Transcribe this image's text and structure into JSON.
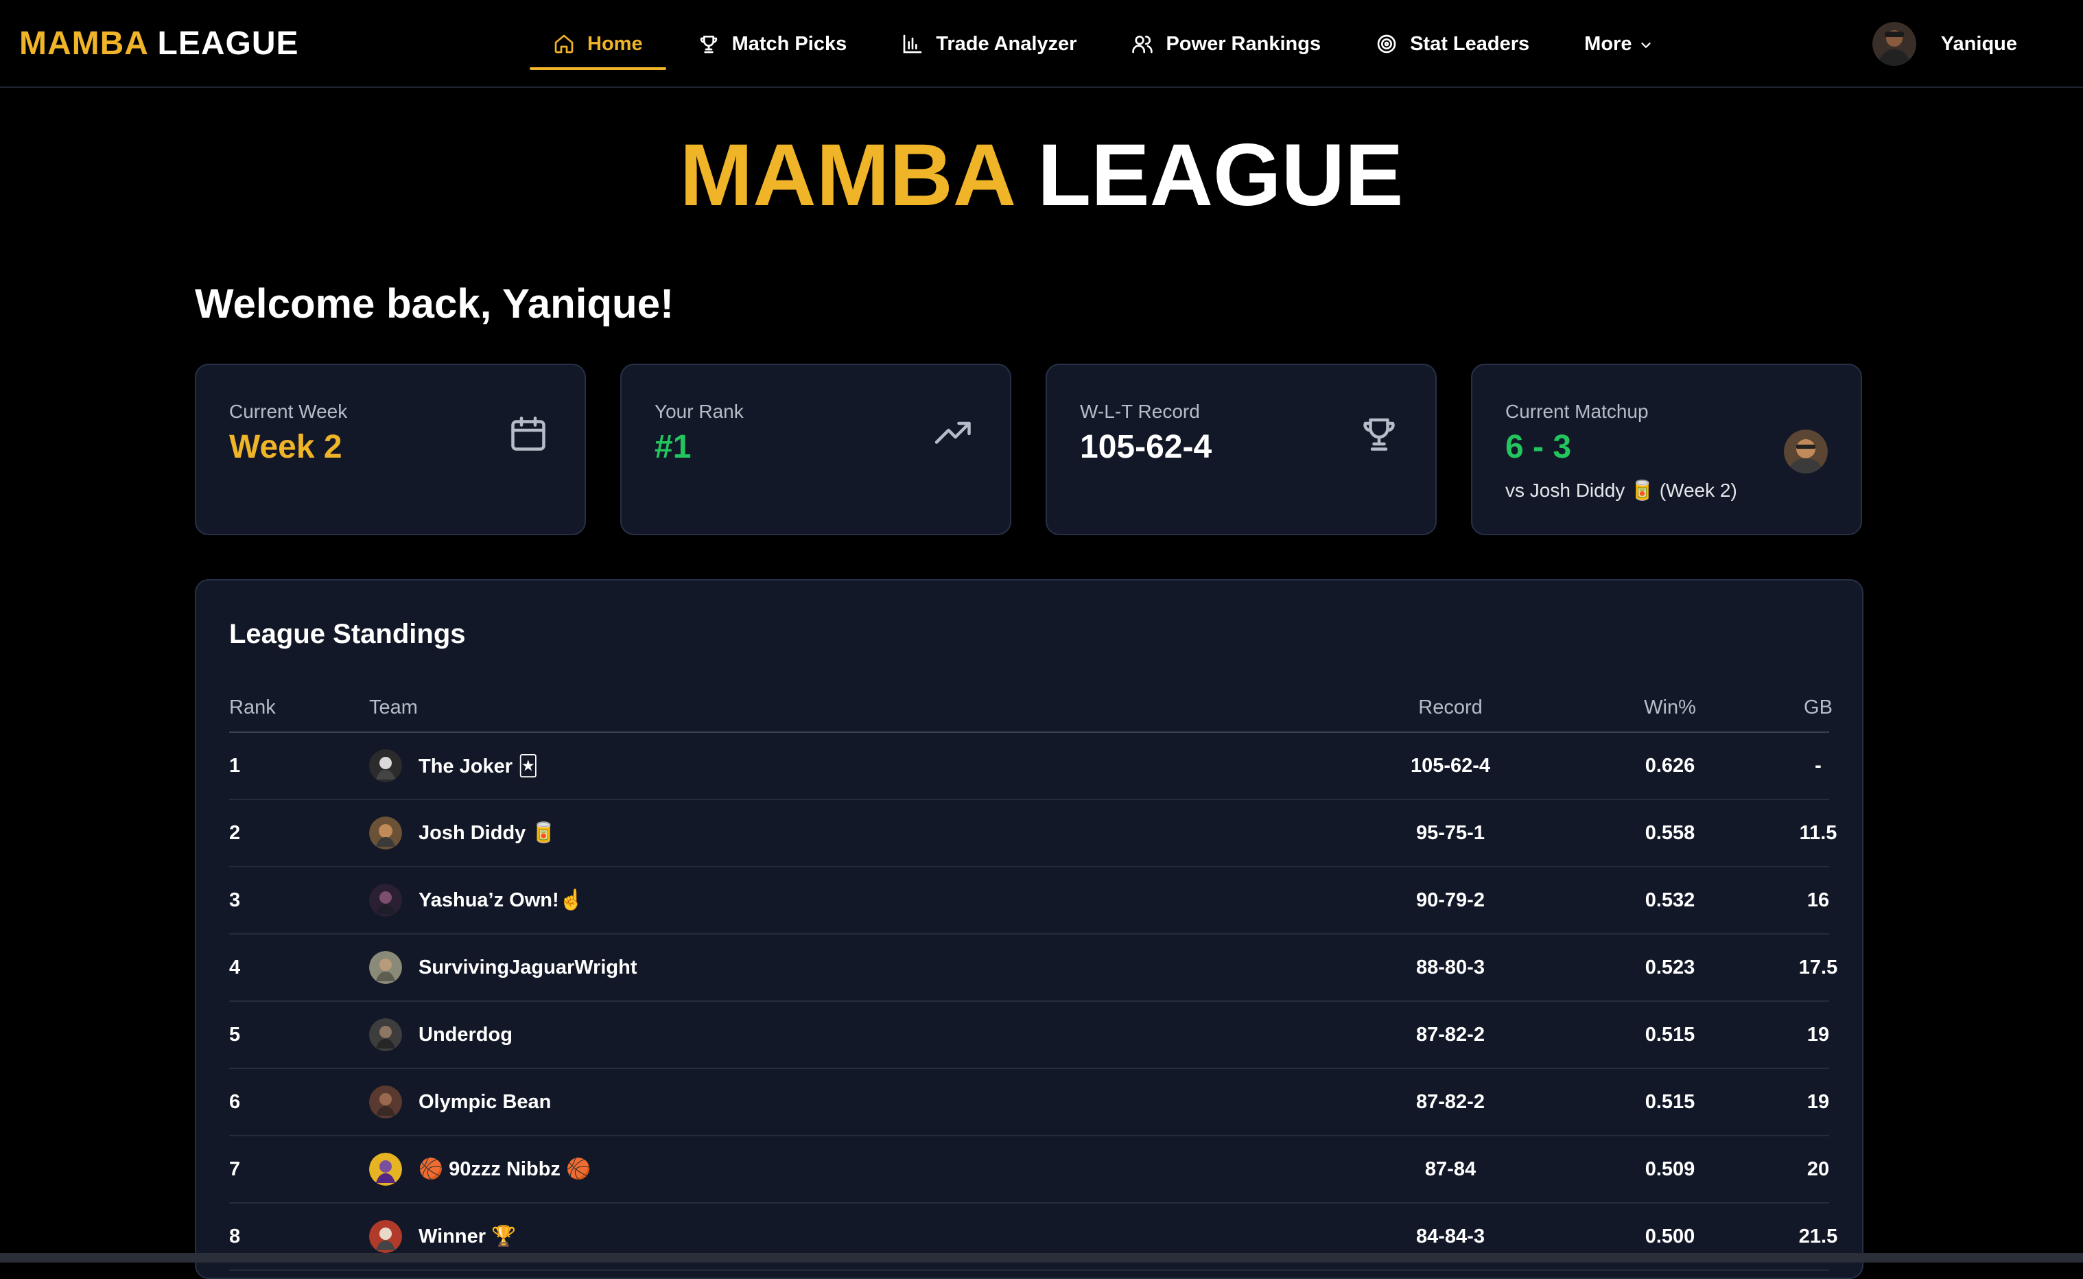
{
  "nav": {
    "brand_gold": "MAMBA",
    "brand_white": "LEAGUE",
    "links": [
      {
        "label": "Home",
        "icon": "home-icon"
      },
      {
        "label": "Match Picks",
        "icon": "trophy-icon"
      },
      {
        "label": "Trade Analyzer",
        "icon": "bar-chart-icon"
      },
      {
        "label": "Power Rankings",
        "icon": "users-icon"
      },
      {
        "label": "Stat Leaders",
        "icon": "target-icon"
      },
      {
        "label": "More",
        "icon": "chevron-down-icon"
      }
    ],
    "active": "Home",
    "user": "Yanique"
  },
  "hero": {
    "title_gold": "MAMBA",
    "title_white": "LEAGUE"
  },
  "welcome": "Welcome back, Yanique!",
  "cards": [
    {
      "label": "Current Week",
      "value": "Week 2",
      "color": "#f0b429",
      "icon": "calendar-icon"
    },
    {
      "label": "Your Rank",
      "value": "#1",
      "color": "#22c55e",
      "icon": "trending-up-icon"
    },
    {
      "label": "W-L-T Record",
      "value": "105-62-4",
      "color": "#ffffff",
      "icon": "trophy-icon"
    },
    {
      "label": "Current Matchup",
      "value": "6 - 3",
      "color": "#22c55e",
      "sub": "vs Josh Diddy 🥫 (Week 2)"
    }
  ],
  "standings": {
    "title": "League Standings",
    "headers": {
      "rank": "Rank",
      "team": "Team",
      "record": "Record",
      "win": "Win%",
      "gb": "GB"
    },
    "rows": [
      {
        "rank": "1",
        "team": "The Joker 🃏",
        "record": "105-62-4",
        "win": "0.626",
        "gb": "-"
      },
      {
        "rank": "2",
        "team": "Josh Diddy 🥫",
        "record": "95-75-1",
        "win": "0.558",
        "gb": "11.5"
      },
      {
        "rank": "3",
        "team": "Yashua’z Own!☝️",
        "record": "90-79-2",
        "win": "0.532",
        "gb": "16"
      },
      {
        "rank": "4",
        "team": "SurvivingJaguarWright",
        "record": "88-80-3",
        "win": "0.523",
        "gb": "17.5"
      },
      {
        "rank": "5",
        "team": "Underdog",
        "record": "87-82-2",
        "win": "0.515",
        "gb": "19"
      },
      {
        "rank": "6",
        "team": "Olympic Bean",
        "record": "87-82-2",
        "win": "0.515",
        "gb": "19"
      },
      {
        "rank": "7",
        "team": "🏀 90zzz Nibbz 🏀",
        "record": "87-84",
        "win": "0.509",
        "gb": "20"
      },
      {
        "rank": "8",
        "team": "Winner 🏆",
        "record": "84-84-3",
        "win": "0.500",
        "gb": "21.5"
      }
    ]
  }
}
